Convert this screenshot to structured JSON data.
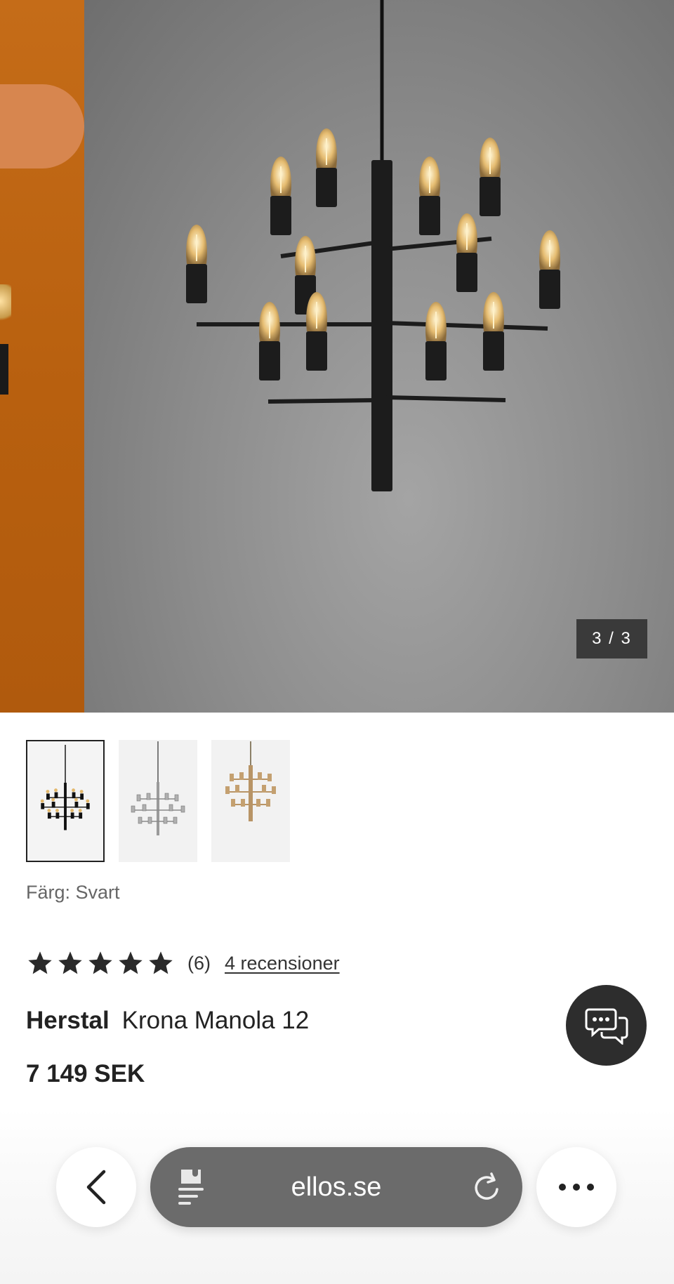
{
  "gallery": {
    "counter": "3 / 3",
    "current_image": 3,
    "total_images": 3
  },
  "thumbnails": [
    {
      "variant": "Svart",
      "selected": true
    },
    {
      "variant": "Krom",
      "selected": false
    },
    {
      "variant": "Mässing",
      "selected": false
    }
  ],
  "product": {
    "color_label": "Färg: Svart",
    "rating_stars": 5,
    "rating_count": "(6)",
    "reviews_link": "4 recensioner",
    "brand": "Herstal",
    "name": "Krona Manola 12",
    "price": "7 149 SEK"
  },
  "chat": {
    "icon": "chat-bubbles-icon"
  },
  "browser": {
    "url": "ellos.se",
    "back_icon": "chevron-left-icon",
    "reader_icon": "reader-mode-icon",
    "reload_icon": "reload-icon",
    "more_icon": "more-dots-icon"
  },
  "colors": {
    "star": "#2a2a2a",
    "chat_bg": "#2d2d2d",
    "url_bar_bg": "#6b6b6b",
    "hero_orange": "#c56c18",
    "hero_grey": "#8d8d8d"
  }
}
